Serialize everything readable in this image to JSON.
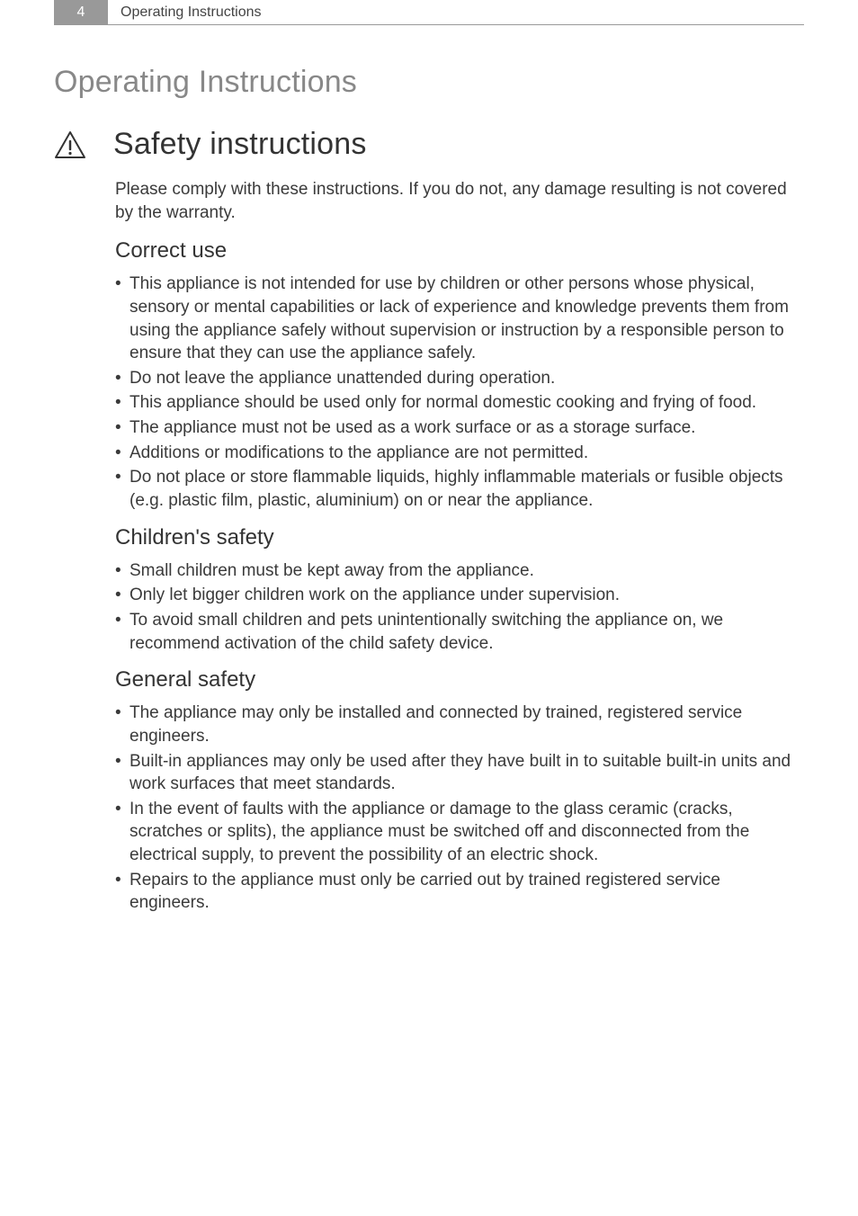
{
  "header": {
    "page_number": "4",
    "running_title": "Operating Instructions"
  },
  "title": "Operating Instructions",
  "section_title": "Safety instructions",
  "intro": "Please comply with these instructions. If you do not, any damage resulting is not covered by the warranty.",
  "sections": {
    "correct_use": {
      "heading": "Correct use",
      "items": [
        "This appliance is not intended for use by children or other persons whose physical, sensory or mental capabilities or lack of experience and knowledge prevents them from using the appliance safely without supervision or instruction by a responsible person to ensure that they can use the appliance safely.",
        "Do not leave the appliance unattended during operation.",
        "This appliance should be used only for normal domestic cooking and frying of food.",
        "The appliance must not be used as a work surface or as a storage surface.",
        "Additions or modifications to the appliance are not permitted.",
        "Do not place or store flammable liquids, highly inflammable materials or fusible objects (e.g. plastic film, plastic, aluminium) on or near the appliance."
      ]
    },
    "childrens_safety": {
      "heading": "Children's safety",
      "items": [
        "Small children must be kept away from the appliance.",
        "Only let bigger children work on the appliance under supervision.",
        "To avoid small children and pets unintentionally switching the appliance on, we recommend activation of the child safety device."
      ]
    },
    "general_safety": {
      "heading": "General safety",
      "items": [
        " The appliance may only be installed and connected by trained, registered service engineers.",
        "Built-in appliances may only be used after they have built in to suitable built-in units and work surfaces that meet standards.",
        "In the event of faults with the appliance or damage to the glass ceramic (cracks, scratches or splits), the appliance must be switched off and disconnected from the electrical supply, to prevent the possibility of an electric shock.",
        "Repairs to the appliance must only be carried out by trained registered service engineers."
      ]
    }
  }
}
